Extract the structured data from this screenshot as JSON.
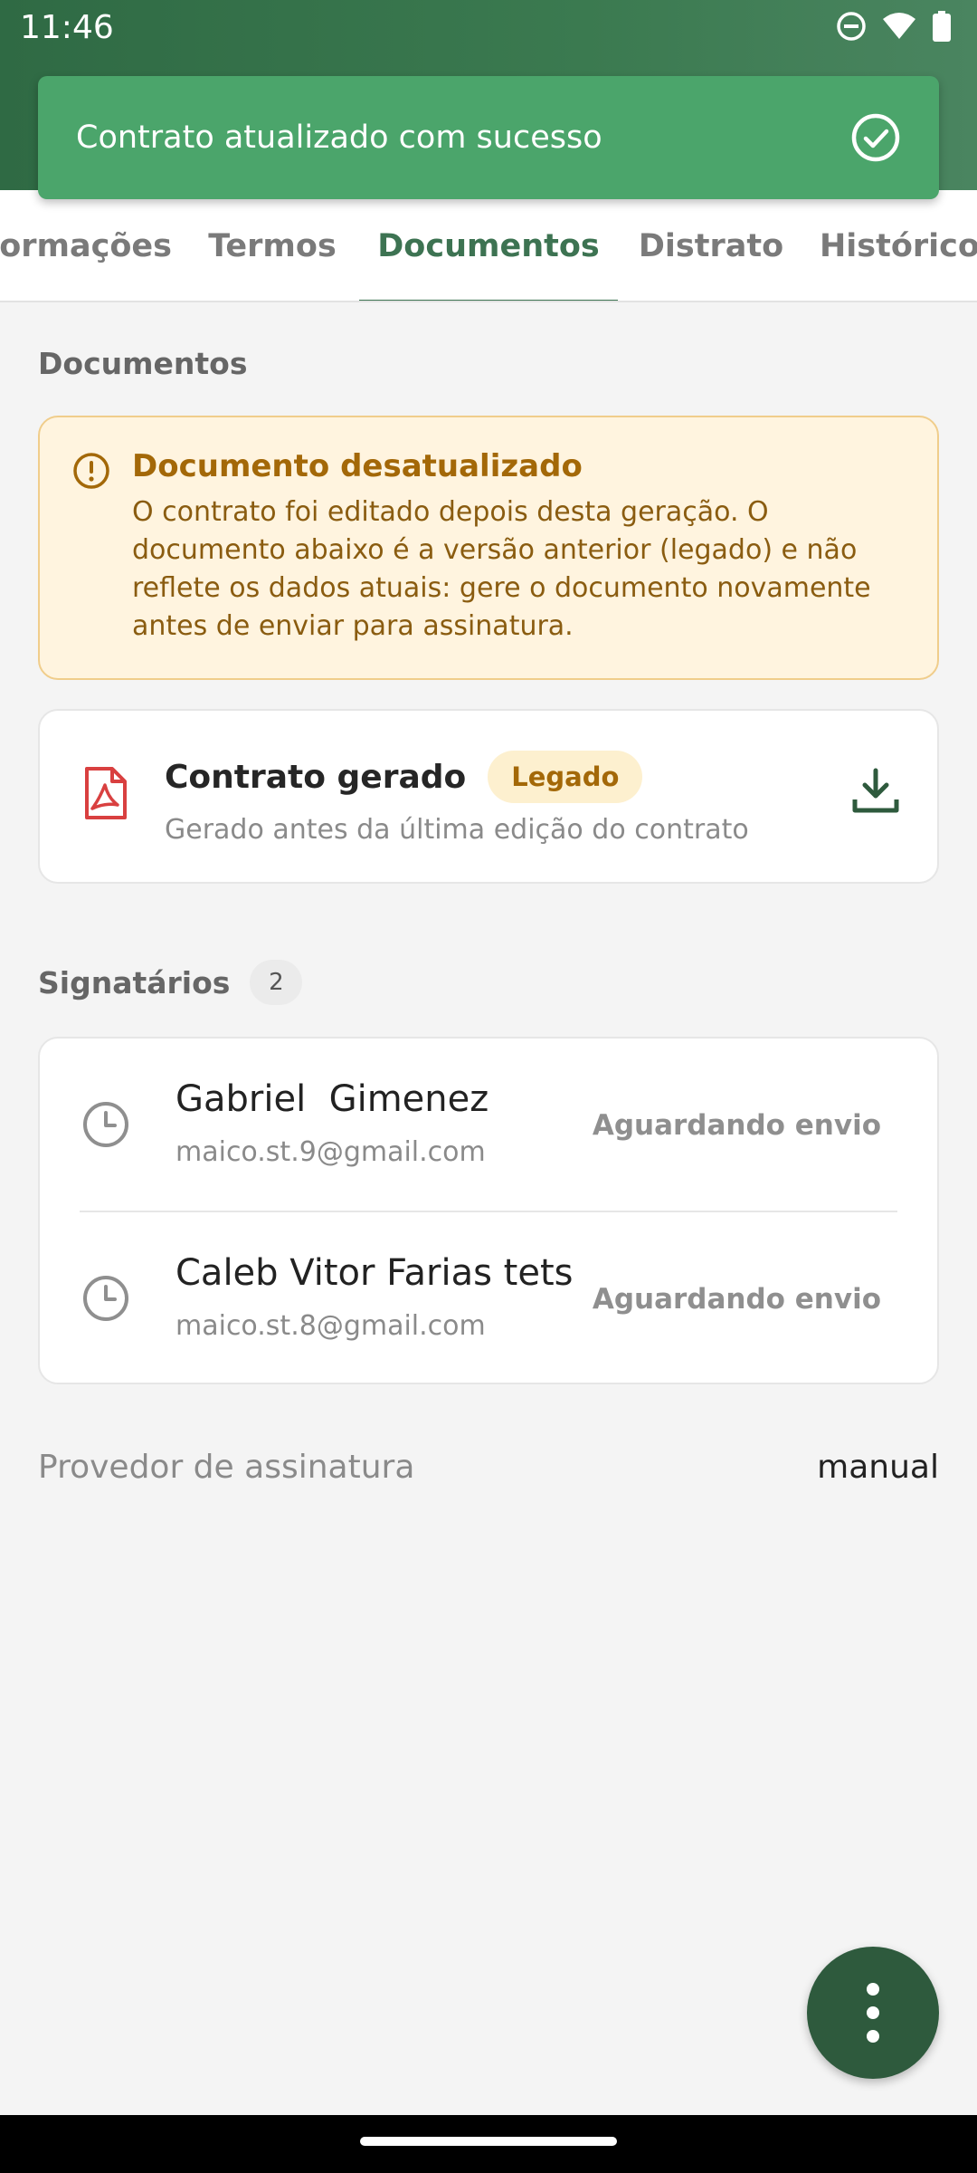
{
  "status_bar": {
    "time": "11:46",
    "icons": [
      "do-not-disturb-icon",
      "wifi-icon",
      "battery-icon"
    ]
  },
  "toast": {
    "message": "Contrato atualizado com sucesso",
    "icon": "check-circle-icon"
  },
  "tabs": [
    {
      "label": "formações",
      "active": false
    },
    {
      "label": "Termos",
      "active": false
    },
    {
      "label": "Documentos",
      "active": true
    },
    {
      "label": "Distrato",
      "active": false
    },
    {
      "label": "Histórico",
      "active": false
    }
  ],
  "documents": {
    "section_title": "Documentos",
    "warning": {
      "title": "Documento desatualizado",
      "body": "O contrato foi editado depois desta geração. O documento abaixo é a versão anterior (legado) e não reflete os dados atuais: gere o documento novamente antes de enviar para assinatura."
    },
    "file": {
      "title": "Contrato gerado",
      "badge": "Legado",
      "subtitle": "Gerado antes da última edição do contrato",
      "icon": "pdf-icon",
      "action_icon": "download-icon"
    }
  },
  "signatories": {
    "title": "Signatários",
    "count": "2",
    "items": [
      {
        "name": "Gabriel  Gimenez",
        "email": "maico.st.9@gmail.com",
        "status": "Aguardando envio"
      },
      {
        "name": "Caleb Vitor Farias tets",
        "email": "maico.st.8@gmail.com",
        "status": "Aguardando envio"
      }
    ]
  },
  "provider": {
    "label": "Provedor de assinatura",
    "value": "manual"
  },
  "colors": {
    "primary": "#3d7352",
    "toast": "#4ba56b",
    "warning_bg": "#fff4df",
    "warning_text": "#a36808",
    "fab": "#2e5a3d",
    "pdf": "#d94040"
  },
  "fab": {
    "icon": "more-vertical-icon"
  }
}
